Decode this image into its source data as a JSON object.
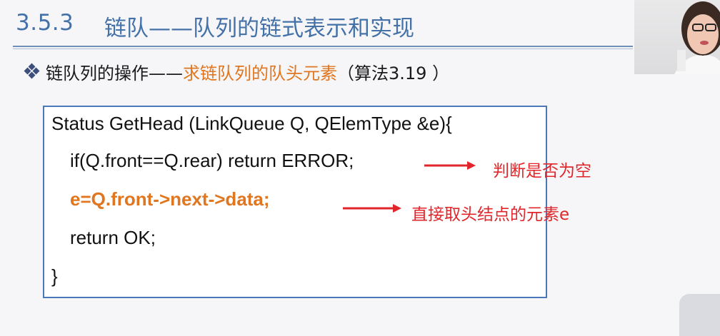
{
  "header": {
    "section_number": "3.5.3",
    "title": "链队——队列的链式表示和实现"
  },
  "bullet": {
    "prefix": "链队列的操作——",
    "highlight": "求链队列的队头元素",
    "suffix": "（算法3.19 ）"
  },
  "code": {
    "line1": "Status GetHead (LinkQueue Q, QElemType &e){",
    "line2": "if(Q.front==Q.rear) return ERROR;",
    "line3": "e=Q.front->next->data;",
    "line4": "return OK;",
    "line5": "}"
  },
  "annotations": {
    "empty_check": "判断是否为空",
    "take_head": "直接取头结点的元素e"
  },
  "colors": {
    "title": "#4472a8",
    "highlight": "#e0761f",
    "annotation": "#e0262a",
    "code_border": "#4a78b8"
  }
}
